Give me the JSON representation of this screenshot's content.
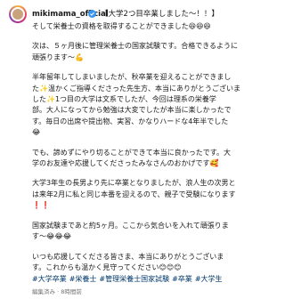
{
  "post": {
    "username": "mikimama_official",
    "title": "【大学2つ目卒業しました〜！！】",
    "paragraphs": [
      [
        "そして栄養士の資格を取得することができました😆😆😆"
      ],
      [
        "次は、５ヶ月後に管理栄養士の国家試験です。合格できるように",
        "頑張ります〜💪"
      ],
      [
        "半年留年してしまいましたが、秋卒業を迎えることができまし",
        "た✨温かくご指導くださった先生方、本当にありがとうございま",
        "した✨1つ目の大学は文系でしたが、今回は理系の栄養学",
        "部。大人になってから勉強は大変でしたが本当に楽しかったで",
        "す。毎日の出席や提出物、実習、かなりハードな4年半でした",
        "😂"
      ],
      [
        "でも、諦めずにやり切ることができて本当に良かったです。大",
        "学のお友達や応援してくださったみなさんのおかげです🥰"
      ],
      [
        "大学3年生の長男より先に卒業となりましたが、浪人生の次男と",
        "は来年2月に私と同じ本番を迎えるので、親子で受験になります",
        "❗❗"
      ],
      [
        "国家試験まであと約5ヶ月。ここから気合いを入れて頑張りま",
        "す〜😂😂😂"
      ],
      [
        "いつも応援してくださる皆さま、本当にありがとうございま",
        "す。これからも温かく見守ってください😊😊😊"
      ]
    ],
    "hashtags": [
      "#大学卒業",
      "#栄養士",
      "#管理栄養士国家試験",
      "#卒業",
      "#大学生"
    ],
    "meta": "編集済み · 8時間前"
  }
}
